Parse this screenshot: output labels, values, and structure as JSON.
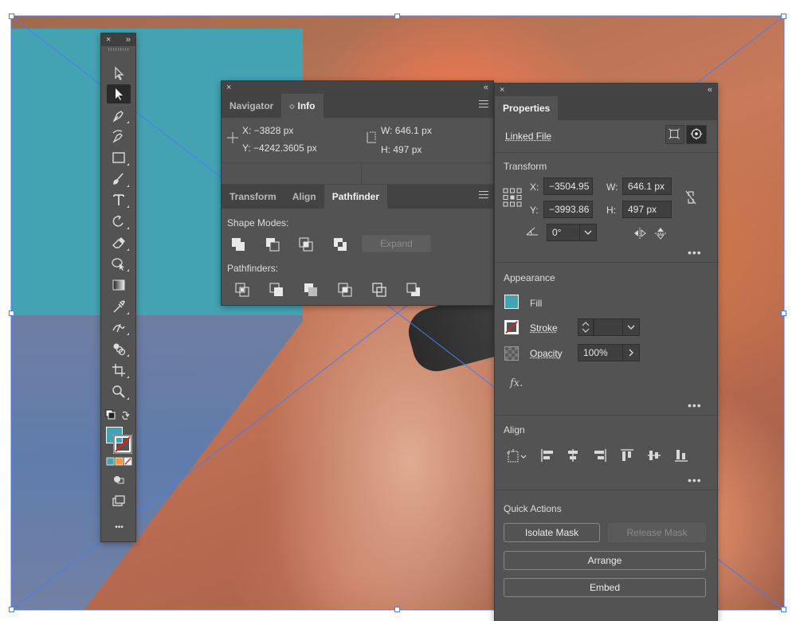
{
  "toolbar": {
    "close": "×",
    "collapse": "»",
    "more": "•••"
  },
  "info_panel": {
    "close": "×",
    "collapse": "«",
    "tabs": [
      "Navigator",
      "Info"
    ],
    "info": {
      "x": "X:  −3828 px",
      "y": "Y:  −4242.3605 px",
      "w": "W:  646.1 px",
      "h": "H:  497 px"
    },
    "sub_tabs": [
      "Transform",
      "Align",
      "Pathfinder"
    ],
    "shape_modes_label": "Shape Modes:",
    "expand_label": "Expand",
    "pathfinders_label": "Pathfinders:"
  },
  "properties": {
    "close": "×",
    "collapse": "«",
    "tab": "Properties",
    "linked_file": "Linked File",
    "transform": {
      "heading": "Transform",
      "x_label": "X:",
      "x": "−3504.95",
      "y_label": "Y:",
      "y": "−3993.86",
      "w_label": "W:",
      "w": "646.1 px",
      "h_label": "H:",
      "h": "497 px",
      "angle": "0°"
    },
    "appearance": {
      "heading": "Appearance",
      "fill": "Fill",
      "stroke": "Stroke",
      "opacity": "Opacity",
      "opacity_value": "100%",
      "fx": "fx."
    },
    "align": {
      "heading": "Align"
    },
    "quick_actions": {
      "heading": "Quick Actions",
      "isolate_mask": "Isolate Mask",
      "release_mask": "Release Mask",
      "arrange": "Arrange",
      "embed": "Embed"
    },
    "more": "•••"
  },
  "colors": {
    "fill": "#44a3b3",
    "panel": "#535353",
    "selection": "#4a7df0"
  }
}
